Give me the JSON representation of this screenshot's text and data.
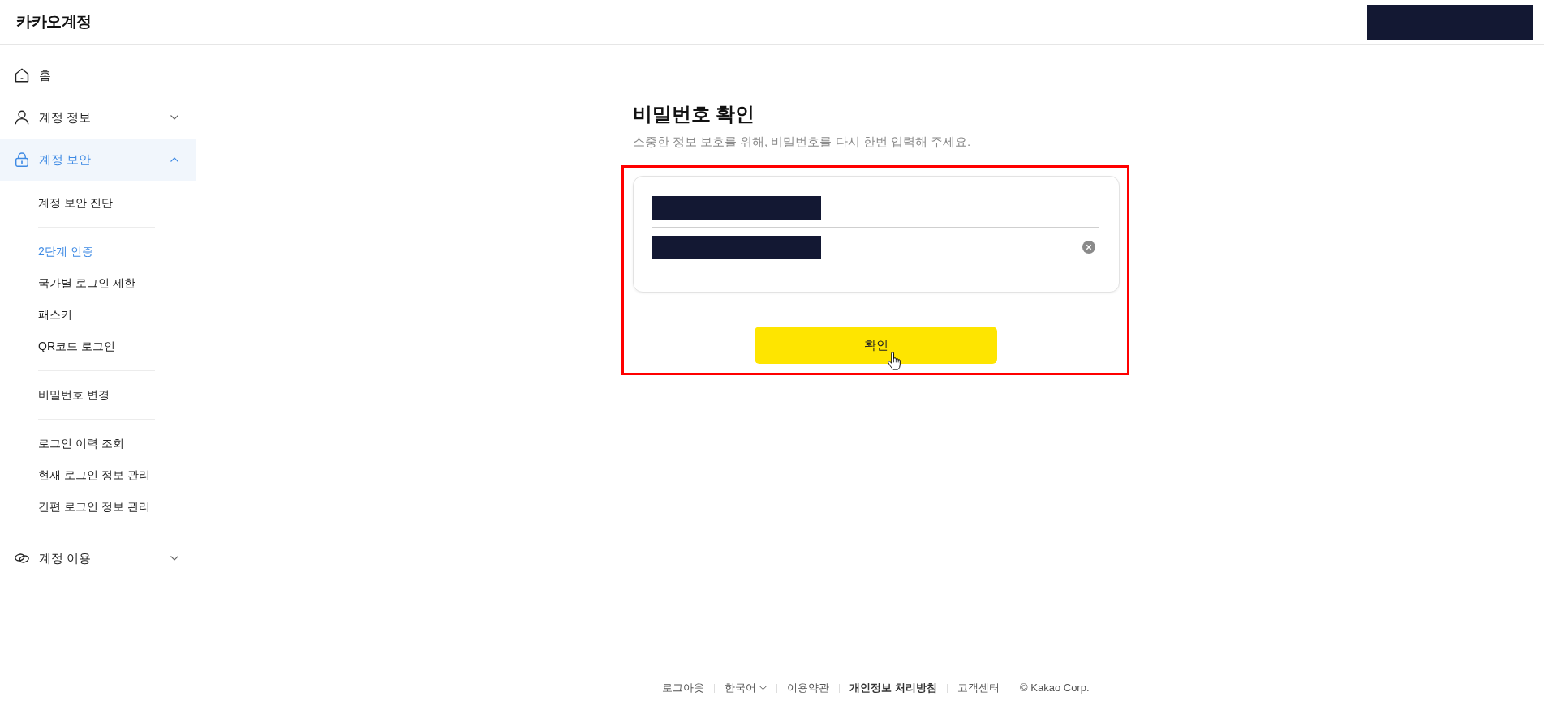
{
  "header": {
    "logo": "카카오계정",
    "account_redacted": true
  },
  "sidebar": {
    "items": [
      {
        "label": "홈",
        "selected": false
      },
      {
        "label": "계정 정보",
        "selected": false,
        "expanded": false
      },
      {
        "label": "계정 보안",
        "selected": true,
        "expanded": true,
        "groups": [
          {
            "items": [
              {
                "label": "계정 보안 진단",
                "selected": false
              }
            ]
          },
          {
            "items": [
              {
                "label": "2단계 인증",
                "selected": true
              },
              {
                "label": "국가별 로그인 제한",
                "selected": false
              },
              {
                "label": "패스키",
                "selected": false
              },
              {
                "label": "QR코드 로그인",
                "selected": false
              }
            ]
          },
          {
            "items": [
              {
                "label": "비밀번호 변경",
                "selected": false
              }
            ]
          },
          {
            "items": [
              {
                "label": "로그인 이력 조회",
                "selected": false
              },
              {
                "label": "현재 로그인 정보 관리",
                "selected": false
              },
              {
                "label": "간편 로그인 정보 관리",
                "selected": false
              }
            ]
          }
        ]
      },
      {
        "label": "계정 이용",
        "selected": false,
        "expanded": false
      }
    ]
  },
  "main": {
    "title": "비밀번호 확인",
    "subtitle": "소중한 정보 보호를 위해, 비밀번호를 다시 한번 입력해 주세요.",
    "highlighted": true,
    "fields": [
      {
        "redacted": true,
        "clearable": false
      },
      {
        "redacted": true,
        "clearable": true
      }
    ],
    "submit_button": "확인",
    "cursor_over_button": true
  },
  "footer": {
    "links": [
      {
        "label": "로그아웃",
        "kind": "link",
        "emphasized": false
      },
      {
        "label": "한국어",
        "kind": "dropdown",
        "emphasized": false
      },
      {
        "label": "이용약관",
        "kind": "link",
        "emphasized": false
      },
      {
        "label": "개인정보 처리방침",
        "kind": "link",
        "emphasized": true
      },
      {
        "label": "고객센터",
        "kind": "link",
        "emphasized": false
      }
    ],
    "copyright": "© Kakao Corp."
  }
}
